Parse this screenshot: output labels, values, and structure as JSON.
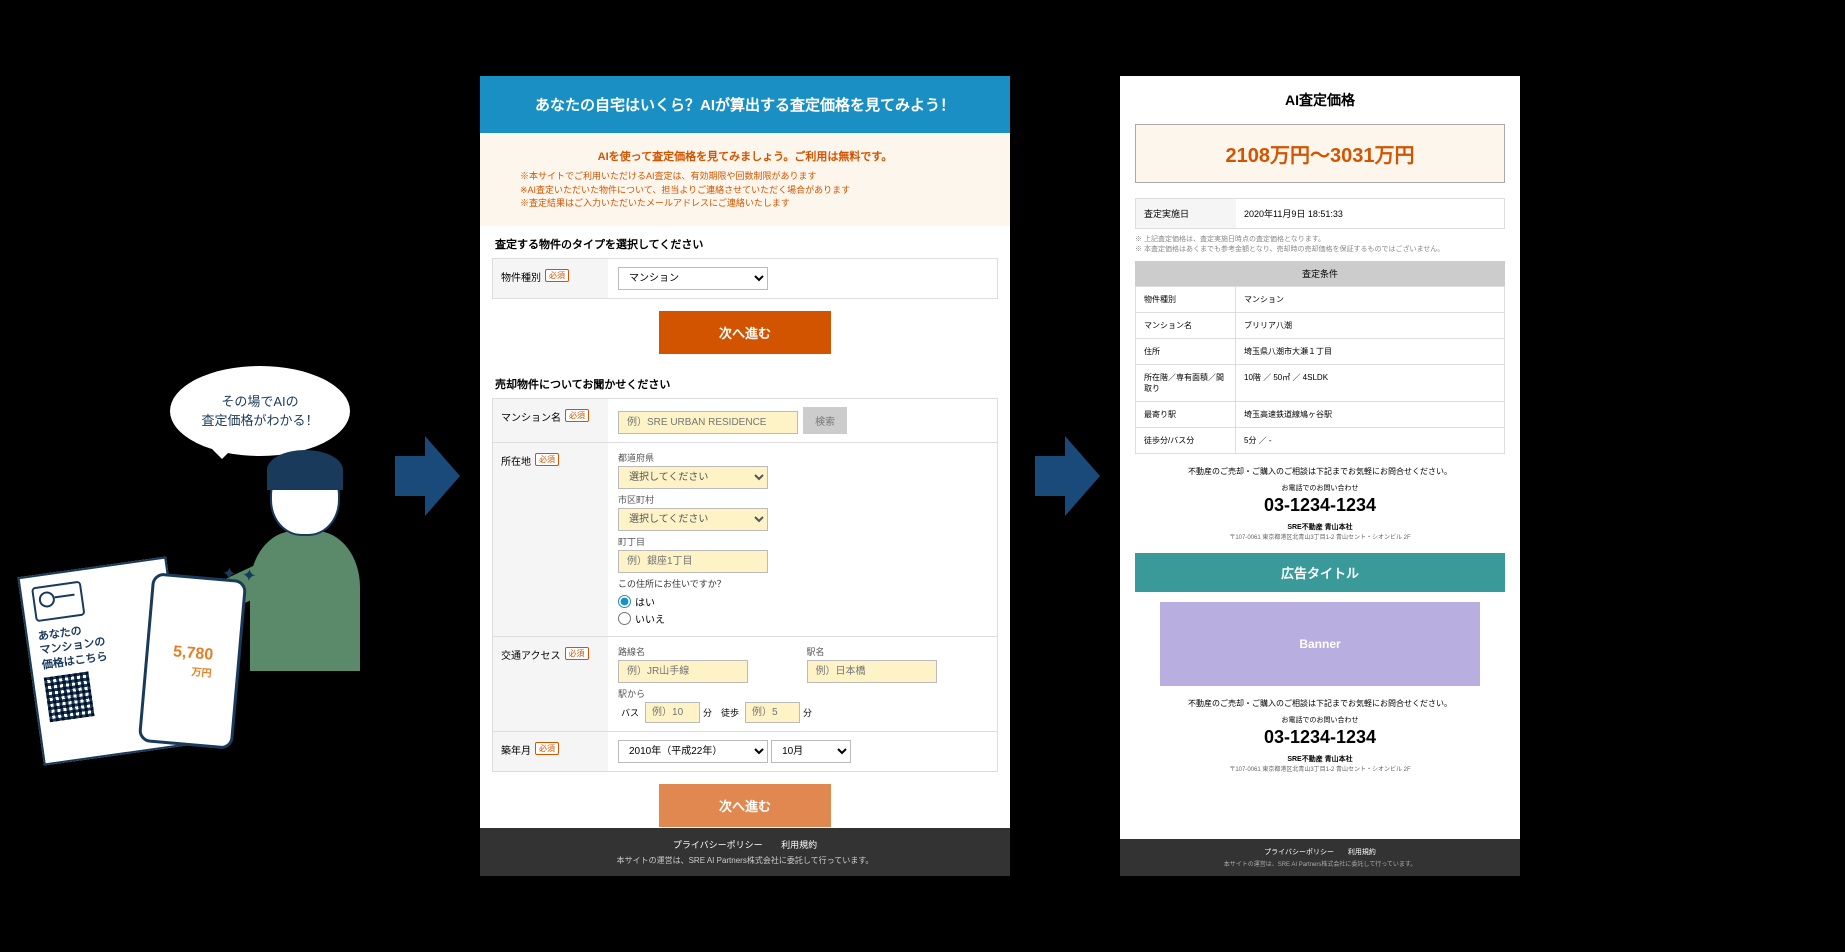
{
  "illust": {
    "speech": "その場でAIの\n査定価格がわかる！",
    "flyer_text": "あなたの\nマンションの\n価格はこちら",
    "phone_price": "5,780",
    "phone_price_unit": "万円"
  },
  "form": {
    "header": "あなたの自宅はいくら？AIが算出する査定価格を見てみよう！",
    "notice_main": "AIを使って査定価格を見てみましょう。ご利用は無料です。",
    "notice_subs": [
      "※本サイトでご利用いただけるAI査定は、有効期限や回数制限があります",
      "※AI査定いただいた物件について、担当よりご連絡させていただく場合があります",
      "※査定結果はご入力いただいたメールアドレスにご連絡いたします"
    ],
    "section1_title": "査定する物件のタイプを選択してください",
    "property_type": {
      "label": "物件種別",
      "req": "必須",
      "value": "マンション"
    },
    "next_btn": "次へ進む",
    "section2_title": "売却物件についてお聞かせください",
    "mansion_name": {
      "label": "マンション名",
      "req": "必須",
      "placeholder": "例）SRE URBAN RESIDENCE",
      "search_btn": "検索"
    },
    "location": {
      "label": "所在地",
      "req": "必須",
      "pref_label": "都道府県",
      "pref_placeholder": "選択してください",
      "city_label": "市区町村",
      "city_placeholder": "選択してください",
      "town_label": "町丁目",
      "town_placeholder": "例）銀座1丁目",
      "residence_q": "この住所にお住いですか？",
      "yes": "はい",
      "no": "いいえ"
    },
    "access": {
      "label": "交通アクセス",
      "req": "必須",
      "line_label": "路線名",
      "line_placeholder": "例）JR山手線",
      "station_label": "駅名",
      "station_placeholder": "例）日本橋",
      "from_station_label": "駅から",
      "bus_label": "バス",
      "bus_placeholder": "例）10",
      "min1": "分",
      "walk_label": "徒歩",
      "walk_placeholder": "例）5",
      "min2": "分"
    },
    "built": {
      "label": "築年月",
      "req": "必須",
      "year": "2010年（平成22年）",
      "month": "10月"
    },
    "footer_links": [
      "プライバシーポリシー",
      "利用規約"
    ],
    "footer_note": "本サイトの運営は、SRE AI Partners株式会社に委託して行っています。"
  },
  "result": {
    "title": "AI査定価格",
    "price": "2108万円～3031万円",
    "date_label": "査定実施日",
    "date_value": "2020年11月9日 18:51:33",
    "disclaimers": [
      "※ 上記査定価格は、査定実施日時点の査定価格となります。",
      "※ 本査定価格はあくまでも参考金額となり、売却時の売却価格を保証するものではございません。"
    ],
    "cond_header": "査定条件",
    "conditions": [
      {
        "label": "物件種別",
        "value": "マンション"
      },
      {
        "label": "マンション名",
        "value": "ブリリア八潮"
      },
      {
        "label": "住所",
        "value": "埼玉県八潮市大瀬１丁目"
      },
      {
        "label": "所在階／専有面積／間取り",
        "value": "10階 ／ 50㎡ ／ 4SLDK"
      },
      {
        "label": "最寄り駅",
        "value": "埼玉高速鉄道線鳩ヶ谷駅"
      },
      {
        "label": "徒歩分/バス分",
        "value": "5分 ／ -"
      }
    ],
    "contact_msg": "不動産のご売却・ご購入のご相談は下記までお気軽にお問合せください。",
    "contact_sub": "お電話でのお問い合わせ",
    "contact_phone": "03-1234-1234",
    "contact_company": "SRE不動産 青山本社",
    "contact_addr": "〒107-0061 東京都港区北青山3丁目1-2 青山セント・シオンビル 2F",
    "ad_title": "広告タイトル",
    "ad_banner": "Banner",
    "footer_links": [
      "プライバシーポリシー",
      "利用規約"
    ],
    "footer_note": "本サイトの運営は、SRE AI Partners株式会社に委託して行っています。"
  }
}
